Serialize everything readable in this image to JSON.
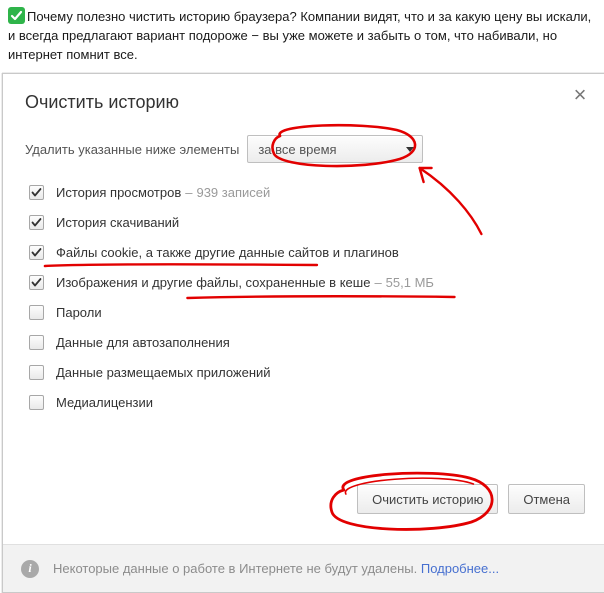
{
  "intro": {
    "text": "Почему полезно чистить историю браузера? Компании видят, что и за какую цену вы искали, и всегда предлагают вариант подороже − вы уже можете и забыть о том, что набивали, но интернет помнит все."
  },
  "dialog": {
    "title": "Очистить историю",
    "close_symbol": "×",
    "delete_label": "Удалить указанные ниже элементы",
    "select": {
      "value": "за все время"
    },
    "options": [
      {
        "checked": true,
        "label": "История просмотров",
        "suffix": "939 записей",
        "dash": "–"
      },
      {
        "checked": true,
        "label": "История скачиваний"
      },
      {
        "checked": true,
        "label": "Файлы cookie, а также другие данные сайтов и плагинов"
      },
      {
        "checked": true,
        "label": "Изображения и другие файлы, сохраненные в кеше",
        "suffix": "55,1 МБ",
        "dash": "–"
      },
      {
        "checked": false,
        "label": "Пароли"
      },
      {
        "checked": false,
        "label": "Данные для автозаполнения"
      },
      {
        "checked": false,
        "label": "Данные размещаемых приложений"
      },
      {
        "checked": false,
        "label": "Медиалицензии"
      }
    ],
    "buttons": {
      "clear": "Очистить историю",
      "cancel": "Отмена"
    },
    "footer": {
      "info_glyph": "i",
      "text": "Некоторые данные о работе в Интернете не будут удалены. ",
      "link": "Подробнее..."
    }
  },
  "annotation_color": "#e20000"
}
